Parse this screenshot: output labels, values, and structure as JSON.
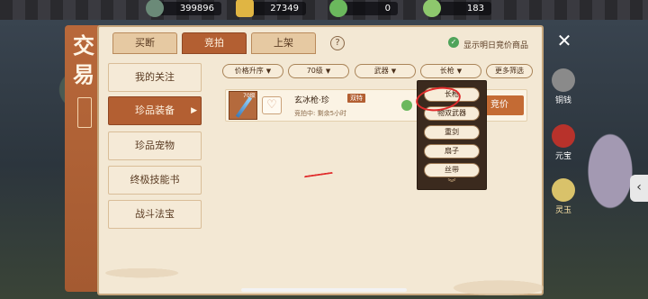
{
  "resources": [
    {
      "icon": "copper-coin-icon",
      "value": "399896",
      "color": "#6b8a78"
    },
    {
      "icon": "gold-ingot-icon",
      "value": "27349",
      "color": "#e0b543"
    },
    {
      "icon": "jade-ring-icon",
      "value": "0",
      "color": "#6bb85d"
    },
    {
      "icon": "jade-coin-icon",
      "value": "183",
      "color": "#8ec86d"
    }
  ],
  "side_title": {
    "char1": "交",
    "char2": "易"
  },
  "tabs": [
    {
      "label": "买断",
      "active": false
    },
    {
      "label": "竞拍",
      "active": true
    },
    {
      "label": "上架",
      "active": false
    }
  ],
  "help_label": "?",
  "show_next_day": {
    "checked": true,
    "label": "显示明日竞价商品"
  },
  "close_label": "✕",
  "categories": [
    {
      "label": "我的关注",
      "active": false
    },
    {
      "label": "珍品装备",
      "active": true
    },
    {
      "label": "珍品宠物",
      "active": false
    },
    {
      "label": "终极技能书",
      "active": false
    },
    {
      "label": "战斗法宝",
      "active": false
    }
  ],
  "active_arrow": "▶",
  "filters": [
    {
      "label": "价格升序",
      "chevron": "▼"
    },
    {
      "label": "70级",
      "chevron": "▼"
    },
    {
      "label": "武器",
      "chevron": "▼"
    },
    {
      "label": "长枪",
      "chevron": "▼"
    },
    {
      "label": "更多筛选",
      "chevron": ""
    }
  ],
  "listing": {
    "level": "70级",
    "name": "玄冰枪·珍",
    "tag": "双特",
    "status": "竞拍中: 剩余5小时",
    "bid_label": "竞价",
    "heart": "♡"
  },
  "dropdown": {
    "options": [
      "长枪",
      "物双武器",
      "重剑",
      "扇子",
      "丝带"
    ],
    "selected": "长枪",
    "more": "︾"
  },
  "currencies": [
    {
      "label": "铜钱",
      "active": false,
      "color": "#8a8a8a"
    },
    {
      "label": "元宝",
      "active": false,
      "color": "#b8322b"
    },
    {
      "label": "灵玉",
      "active": true,
      "color": "#d9c26a"
    }
  ],
  "scroll_tab": "‹"
}
